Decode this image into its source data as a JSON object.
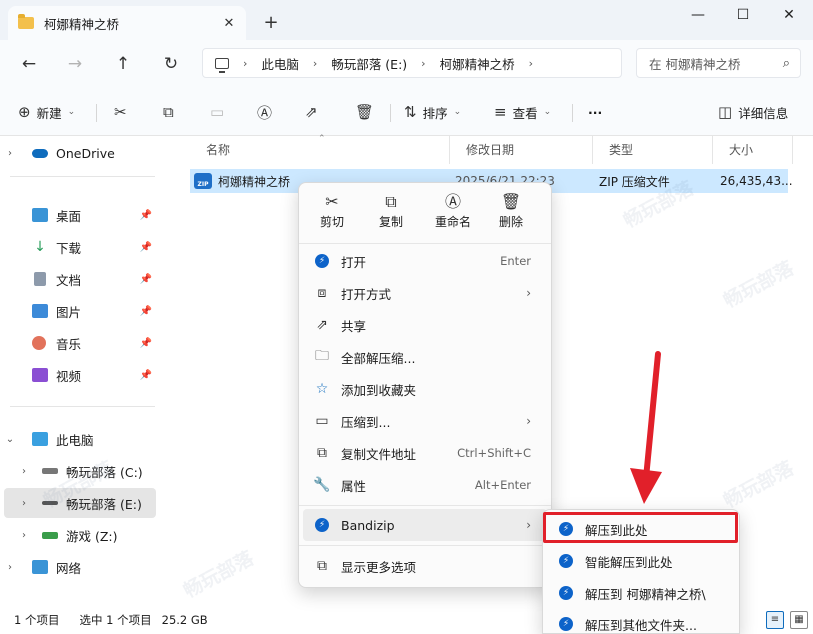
{
  "window": {
    "tab_title": "柯娜精神之桥",
    "new_tab": "+",
    "close_tab": "✕",
    "minimize": "—",
    "maximize": "☐",
    "close": "✕"
  },
  "address": {
    "crumbs": [
      "此电脑",
      "畅玩部落 (E:)",
      "柯娜精神之桥"
    ],
    "search_placeholder": "在 柯娜精神之桥"
  },
  "toolbar": {
    "new_label": "新建",
    "sort_label": "排序",
    "view_label": "查看",
    "more_label": "···",
    "details_label": "详细信息"
  },
  "sidebar": {
    "items": [
      {
        "label": "OneDrive",
        "icon": "cloud-icon",
        "color": "#0f6cbd"
      },
      {
        "label": "桌面",
        "icon": "desktop-icon",
        "color": "#3a94d6",
        "pinned": true
      },
      {
        "label": "下载",
        "icon": "download-icon",
        "color": "#2a9d5c",
        "pinned": true
      },
      {
        "label": "文档",
        "icon": "document-icon",
        "color": "#6e7b8b",
        "pinned": true
      },
      {
        "label": "图片",
        "icon": "pictures-icon",
        "color": "#3c8ad8",
        "pinned": true
      },
      {
        "label": "音乐",
        "icon": "music-icon",
        "color": "#e2725b",
        "pinned": true
      },
      {
        "label": "视频",
        "icon": "video-icon",
        "color": "#8a4fd3",
        "pinned": true
      },
      {
        "label": "此电脑",
        "icon": "pc-icon",
        "color": "#3aa0e0"
      },
      {
        "label": "畅玩部落 (C:)",
        "icon": "drive-icon",
        "color": "#555555"
      },
      {
        "label": "畅玩部落 (E:)",
        "icon": "drive-icon",
        "color": "#555555"
      },
      {
        "label": "游戏 (Z:)",
        "icon": "drive-icon",
        "color": "#3a9d4a"
      },
      {
        "label": "网络",
        "icon": "network-icon",
        "color": "#3a94d6"
      }
    ]
  },
  "list": {
    "headers": [
      "名称",
      "修改日期",
      "类型",
      "大小"
    ],
    "rows": [
      {
        "name": "柯娜精神之桥",
        "date": "2025/6/21 22:23",
        "type": "ZIP 压缩文件",
        "size": "26,435,43..."
      }
    ]
  },
  "context_menu": {
    "quick_actions": [
      {
        "label": "剪切",
        "icon": "scissors-icon"
      },
      {
        "label": "复制",
        "icon": "copy-icon"
      },
      {
        "label": "重命名",
        "icon": "rename-icon"
      },
      {
        "label": "删除",
        "icon": "trash-icon"
      }
    ],
    "items": [
      {
        "label": "打开",
        "shortcut": "Enter"
      },
      {
        "label": "打开方式",
        "submenu": true
      },
      {
        "label": "共享"
      },
      {
        "label": "全部解压缩..."
      },
      {
        "label": "添加到收藏夹"
      },
      {
        "label": "压缩到...",
        "submenu": true
      },
      {
        "label": "复制文件地址",
        "shortcut": "Ctrl+Shift+C"
      },
      {
        "label": "属性",
        "shortcut": "Alt+Enter"
      },
      {
        "label": "Bandizip",
        "submenu": true
      },
      {
        "label": "显示更多选项"
      }
    ]
  },
  "bandizip_submenu": {
    "items": [
      "解压到此处",
      "智能解压到此处",
      "解压到 柯娜精神之桥\\",
      "解压到其他文件夹..."
    ]
  },
  "status": {
    "item_count": "1 个项目",
    "selected": "选中 1 个项目",
    "size": "25.2 GB"
  },
  "colors": {
    "accent_highlight": "#e1202a",
    "selection": "#cce8ff",
    "bandizip_blue": "#0d63c9"
  }
}
